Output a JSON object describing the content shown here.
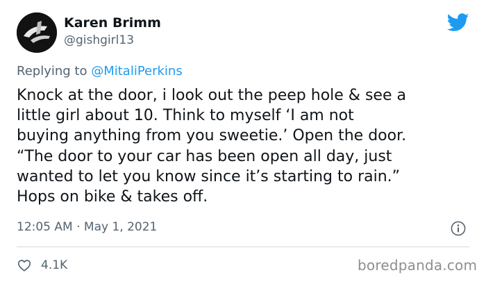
{
  "author": {
    "name": "Karen Brimm",
    "handle": "@gishgirl13",
    "avatar_icon": "avatar-image"
  },
  "brand_icon": "twitter-bird-icon",
  "brand_color": "#1d9bf0",
  "reply": {
    "prefix": "Replying to ",
    "mention": "@MitaliPerkins"
  },
  "tweet": {
    "lines": [
      "Knock at the door, i look out the peep hole & see a",
      "little girl about 10. Think to myself ‘I am not",
      "buying anything from you sweetie.’ Open the door.",
      "“The door to your car has been open all day, just",
      "wanted to let you know since it’s starting to rain.”",
      "Hops on bike & takes off."
    ]
  },
  "timestamp": "12:05 AM · May 1, 2021",
  "info_icon": "info-icon",
  "likes": {
    "icon": "heart-icon",
    "count": "4.1K"
  },
  "watermark": "boredpanda.com"
}
